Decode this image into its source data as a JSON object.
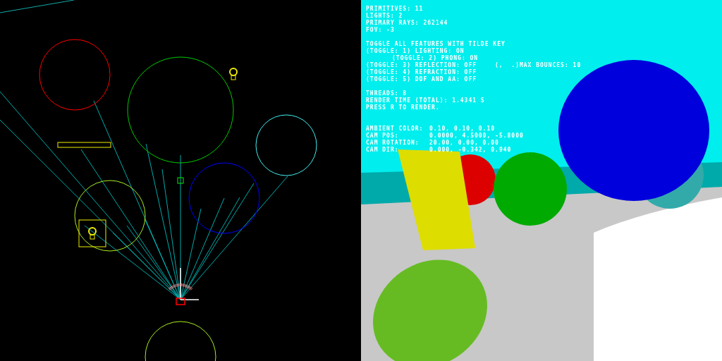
{
  "render_view": {
    "hud": {
      "stats": [
        "PRIMITIVES: 11",
        "LIGHTS: 2",
        "PRIMARY RAYS: 262144",
        "FOV: -3"
      ],
      "toggle_heading": "TOGGLE ALL FEATURES WITH TILDE KEY",
      "toggles": [
        {
          "text": "(TOGGLE: 1) LIGHTING: ON",
          "indent": false
        },
        {
          "text": "(TOGGLE: 2) PHONG: ON",
          "indent": true
        },
        {
          "text": "(TOGGLE: 3) REFLECTION: OFF",
          "indent": false,
          "extra": "(,  .)MAX BOUNCES: 10"
        },
        {
          "text": "(TOGGLE: 4) REFRACTION: OFF",
          "indent": false
        },
        {
          "text": "(TOGGLE: 5) DOF AND AA: OFF",
          "indent": false
        }
      ],
      "status": [
        "THREADS: 8",
        "RENDER TIME (TOTAL): 1.4341 S",
        "PRESS R TO RENDER."
      ],
      "camera": [
        {
          "label": "AMBIENT COLOR:",
          "value": "0.10, 0.10, 0.10"
        },
        {
          "label": "CAM POS:",
          "value": "0.0000, 4.5000, -5.8000"
        },
        {
          "label": "CAM ROTATION:",
          "value": "20.00, 0.00, 0.00"
        },
        {
          "label": "CAM DIR:",
          "value": "0.000, -0.342, 0.940"
        }
      ]
    }
  }
}
